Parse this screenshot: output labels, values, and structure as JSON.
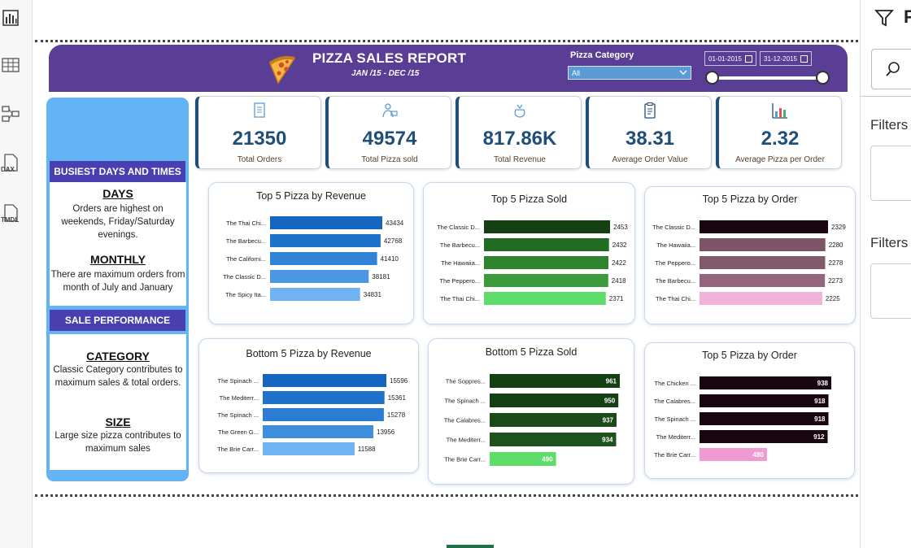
{
  "header": {
    "title": "PIZZA SALES REPORT",
    "subtitle": "JAN /15 - DEC /15",
    "category_label": "Pizza Category",
    "category_value": "All",
    "date_start": "01-01-2015",
    "date_end": "31-12-2015"
  },
  "kpis": [
    {
      "value": "21350",
      "label": "Total Orders"
    },
    {
      "value": "49574",
      "label": "Total Pizza sold"
    },
    {
      "value": "817.86K",
      "label": "Total Revenue"
    },
    {
      "value": "38.31",
      "label": "Average Order Value"
    },
    {
      "value": "2.32",
      "label": "Average Pizza per Order"
    }
  ],
  "side": {
    "busiest_heading": "BUSIEST DAYS AND TIMES",
    "days_title": "DAYS",
    "days_text": "Orders are highest on weekends, Friday/Saturday evenings.",
    "monthly_title": "MONTHLY",
    "monthly_text": "There are maximum orders from month of July and January",
    "performance_heading": "SALE PERFORMANCE",
    "category_title": "CATEGORY",
    "category_text": "Classic Category contributes to maximum sales & total orders.",
    "size_title": "SIZE",
    "size_text": "Large size pizza contributes to maximum sales"
  },
  "filters": {
    "pane_title": "F",
    "label_1": "Filters",
    "label_2": "Filters"
  },
  "colors": {
    "header": "#5a3d95",
    "kpi_value": "#1f4e79",
    "side_panel": "#64b3f4",
    "side_heading": "#4a3fb0"
  },
  "chart_data": [
    {
      "type": "bar",
      "orientation": "horizontal",
      "title": "Top 5 Pizza by Revenue",
      "categories": [
        "The Thai Chi...",
        "The Barbecu...",
        "The Californi...",
        "The Classic D...",
        "The Spicy Ita..."
      ],
      "values": [
        43434,
        42768,
        41410,
        38181,
        34831
      ],
      "colors": [
        "#1565c0",
        "#1f72c9",
        "#3283d6",
        "#4b97e4",
        "#6fb3f2"
      ],
      "xlim": [
        0,
        43434
      ]
    },
    {
      "type": "bar",
      "orientation": "horizontal",
      "title": "Top 5 Pizza Sold",
      "categories": [
        "The Classic D...",
        "The Barbecu...",
        "The Hawaiia...",
        "The Peppero...",
        "The Thai Chi..."
      ],
      "values": [
        2453,
        2432,
        2422,
        2418,
        2371
      ],
      "colors": [
        "#133f13",
        "#226b22",
        "#2d842d",
        "#3b9b3b",
        "#5fdd6a"
      ],
      "xlim": [
        0,
        2453
      ]
    },
    {
      "type": "bar",
      "orientation": "horizontal",
      "title": "Top 5 Pizza by Order",
      "categories": [
        "The Classic D...",
        "The Hawaiia...",
        "The Peppero...",
        "The Barbecu...",
        "The Thai Chi..."
      ],
      "values": [
        2329,
        2280,
        2278,
        2273,
        2225
      ],
      "colors": [
        "#1a0610",
        "#7e5468",
        "#815a6c",
        "#93667d",
        "#f2b3da"
      ],
      "xlim": [
        0,
        2329
      ]
    },
    {
      "type": "bar",
      "orientation": "horizontal",
      "title": "Bottom 5 Pizza by Revenue",
      "categories": [
        "The Spinach ...",
        "The Mediterr...",
        "The Spinach ...",
        "The Green G...",
        "The Brie Carr..."
      ],
      "values": [
        15596,
        15361,
        15278,
        13956,
        11588
      ],
      "colors": [
        "#1565c0",
        "#1f72c9",
        "#2a7dd2",
        "#3f8fde",
        "#6fb3f2"
      ],
      "xlim": [
        0,
        15596
      ]
    },
    {
      "type": "bar",
      "orientation": "horizontal",
      "title": "Bottom 5 Pizza Sold",
      "categories": [
        "The Soppres...",
        "The Spinach ...",
        "The Calabres...",
        "The Mediterr...",
        "The Brie Carr..."
      ],
      "values": [
        961,
        950,
        937,
        934,
        490
      ],
      "colors": [
        "#133f13",
        "#133f13",
        "#1a4a1a",
        "#1e521e",
        "#5fdd6a"
      ],
      "xlim": [
        0,
        961
      ]
    },
    {
      "type": "bar",
      "orientation": "horizontal",
      "title": "Top 5 Pizza by Order",
      "categories": [
        "The Chicken ...",
        "The Calabres...",
        "The Spinach ...",
        "The Mediterr...",
        "The Brie Carr..."
      ],
      "values": [
        938,
        918,
        918,
        912,
        480
      ],
      "colors": [
        "#1a0610",
        "#1a0610",
        "#1a0610",
        "#1a0610",
        "#ef9ad0"
      ],
      "xlim": [
        0,
        938
      ]
    }
  ]
}
